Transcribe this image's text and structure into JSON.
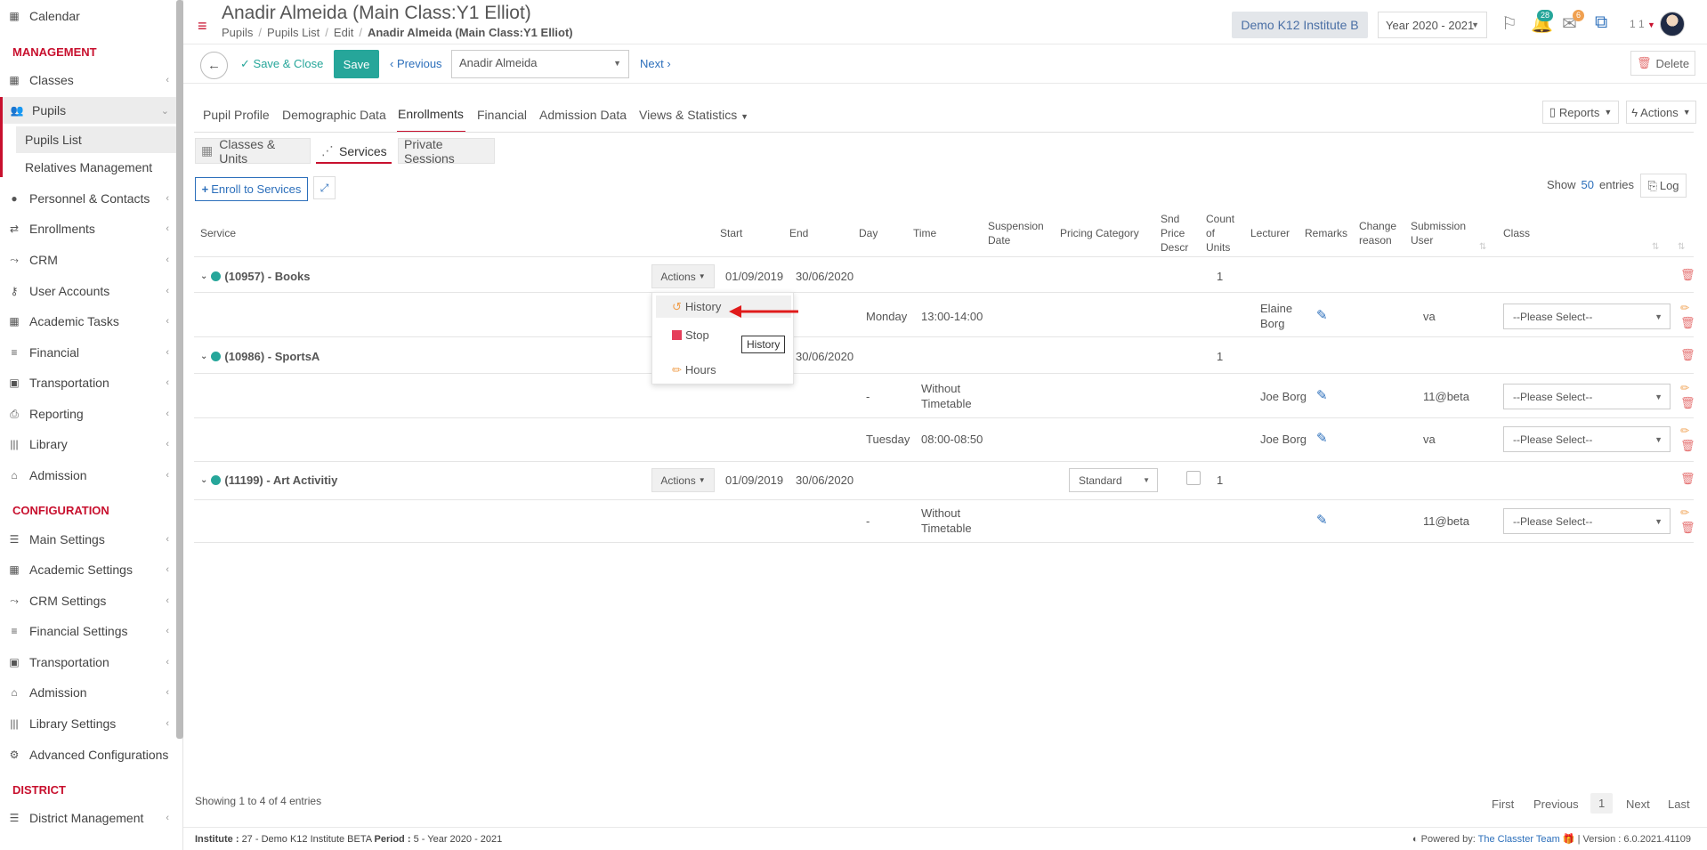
{
  "sidebar": {
    "calendar": "Calendar",
    "sections": {
      "management": "MANAGEMENT",
      "configuration": "CONFIGURATION",
      "district": "DISTRICT"
    },
    "management_items": [
      "Classes",
      "Pupils",
      "Personnel & Contacts",
      "Enrollments",
      "CRM",
      "User Accounts",
      "Academic Tasks",
      "Financial",
      "Transportation",
      "Reporting",
      "Library",
      "Admission"
    ],
    "pupils_sub": [
      "Pupils List",
      "Relatives Management"
    ],
    "configuration_items": [
      "Main Settings",
      "Academic Settings",
      "CRM Settings",
      "Financial Settings",
      "Transportation",
      "Admission",
      "Library Settings",
      "Advanced Configurations"
    ],
    "district_items": [
      "District Management"
    ]
  },
  "header": {
    "title": "Anadir Almeida (Main Class:Y1 Elliot)",
    "breadcrumb": [
      "Pupils",
      "Pupils List",
      "Edit",
      "Anadir Almeida (Main Class:Y1 Elliot)"
    ],
    "institute": "Demo K12 Institute B",
    "year": "Year 2020 - 2021",
    "notifications_count": "28",
    "messages_count": "6",
    "user_count": "1 1"
  },
  "toolbar": {
    "save_close": "Save & Close",
    "save": "Save",
    "previous": "Previous",
    "pupil_value": "Anadir Almeida",
    "next": "Next",
    "delete": "Delete"
  },
  "tabs": [
    "Pupil Profile",
    "Demographic Data",
    "Enrollments",
    "Financial",
    "Admission Data",
    "Views & Statistics"
  ],
  "subtabs": [
    "Classes & Units",
    "Services",
    "Private Sessions"
  ],
  "reports": "Reports",
  "actions": "Actions",
  "enroll": "Enroll to Services",
  "show": "Show",
  "entries_count": "50",
  "entries": "entries",
  "log": "Log",
  "table": {
    "headers": {
      "service": "Service",
      "start": "Start",
      "end": "End",
      "day": "Day",
      "time": "Time",
      "suspension_1": "Suspension",
      "suspension_2": "Date",
      "pricing": "Pricing Category",
      "snd_1": "Snd",
      "snd_2": "Price",
      "snd_3": "Descr",
      "count_1": "Count",
      "count_2": "of",
      "count_3": "Units",
      "lecturer": "Lecturer",
      "remarks": "Remarks",
      "change_1": "Change",
      "change_2": "reason",
      "submission_1": "Submission",
      "submission_2": "User",
      "class": "Class"
    },
    "services": [
      {
        "name": "(10957) - Books",
        "actions": "Actions",
        "start": "01/09/2019",
        "end": "30/06/2020",
        "count": "1"
      },
      {
        "name": "(10986) - SportsA",
        "end": "30/06/2020",
        "count": "1"
      },
      {
        "name": "(11199) - Art Activitiy",
        "actions": "Actions",
        "start": "01/09/2019",
        "end": "30/06/2020",
        "pricing": "Standard",
        "count": "1"
      }
    ],
    "rows": [
      {
        "day": "Monday",
        "time": "13:00-14:00",
        "lecturer_1": "Elaine",
        "lecturer_2": "Borg",
        "user": "va",
        "class": "--Please Select--"
      },
      {
        "day": "-",
        "time_1": "Without",
        "time_2": "Timetable",
        "lecturer": "Joe Borg",
        "user": "11@beta",
        "class": "--Please Select--"
      },
      {
        "day": "Tuesday",
        "time": "08:00-08:50",
        "lecturer": "Joe Borg",
        "user": "va",
        "class": "--Please Select--"
      },
      {
        "day": "-",
        "time_1": "Without",
        "time_2": "Timetable",
        "user": "11@beta",
        "class": "--Please Select--"
      }
    ]
  },
  "dropdown": {
    "items": [
      "History",
      "Stop",
      "Hours"
    ],
    "tooltip": "History"
  },
  "footer": {
    "showing": "Showing 1 to 4 of 4 entries",
    "pagination": [
      "First",
      "Previous",
      "1",
      "Next",
      "Last"
    ],
    "institute_label": "Institute :",
    "institute_value": "27 - Demo K12 Institute BETA",
    "period_label": "Period :",
    "period_value": "5 - Year 2020 - 2021",
    "powered_by": "Powered by:",
    "team": "The Classter Team",
    "version": "| Version : 6.0.2021.41109"
  },
  "colors": {
    "accent_red": "#c8102e",
    "teal": "#26a69a",
    "link_blue": "#2c6fbb"
  }
}
